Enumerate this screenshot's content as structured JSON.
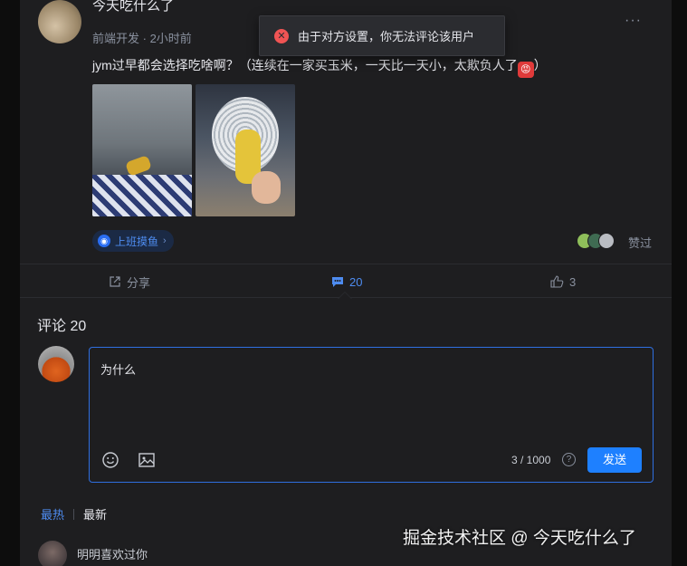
{
  "post": {
    "author_name": "今天吃什么了",
    "author_role": "前端开发",
    "time_ago": "2小时前",
    "text": "jym过早都会选择吃啥啊？（连续在一家买玉米，一天比一天小，太欺负人了",
    "text_end": "）",
    "more": "···",
    "tag": "上班摸鱼",
    "liked_label": "赞过"
  },
  "actions": {
    "share": "分享",
    "comments": "20",
    "likes": "3"
  },
  "comments": {
    "heading": "评论 20",
    "input_value": "为什么",
    "char_count": "3 / 1000",
    "help": "?",
    "send": "发送",
    "sort_hot": "最热",
    "sort_new": "最新",
    "first_commenter": "明明喜欢过你"
  },
  "toast": {
    "message": "由于对方设置，你无法评论该用户"
  },
  "watermark": "掘金技术社区 @ 今天吃什么了",
  "colors": {
    "accent": "#1e80ff",
    "link": "#4e8cf0",
    "error": "#f05454",
    "background": "#1e1e20"
  }
}
